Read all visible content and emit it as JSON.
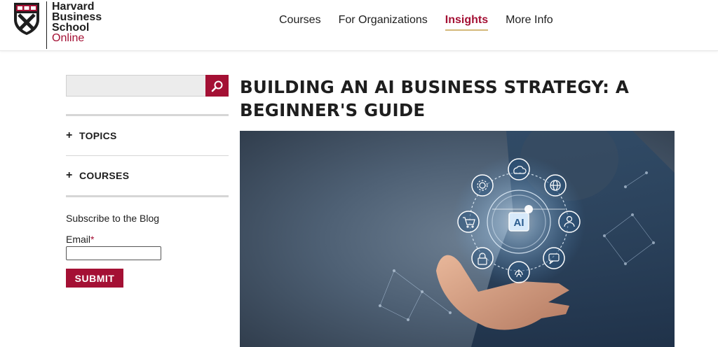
{
  "header": {
    "logo": {
      "line1": "Harvard",
      "line2": "Business",
      "line3": "School",
      "line4": "Online"
    },
    "nav": [
      {
        "label": "Courses",
        "active": false
      },
      {
        "label": "For Organizations",
        "active": false
      },
      {
        "label": "Insights",
        "active": true
      },
      {
        "label": "More Info",
        "active": false
      }
    ]
  },
  "sidebar": {
    "search": {
      "value": "",
      "placeholder": ""
    },
    "accordions": [
      {
        "label": "TOPICS",
        "icon": "plus-icon"
      },
      {
        "label": "COURSES",
        "icon": "plus-icon"
      }
    ],
    "subscribe": {
      "title": "Subscribe to the Blog",
      "email_label": "Email",
      "required_mark": "*",
      "submit_label": "SUBMIT"
    }
  },
  "article": {
    "title": "BUILDING AN AI BUSINESS STRATEGY: A BEGINNER'S GUIDE",
    "hero_image": {
      "center_label": "AI",
      "icons": [
        "cloud-icon",
        "globe-icon",
        "user-icon",
        "chat-icon",
        "fingerprint-icon",
        "lock-icon",
        "cart-icon",
        "gear-icon"
      ]
    }
  },
  "colors": {
    "brand": "#a41034",
    "nav_underline": "#d4b87a",
    "text": "#1e1e1e"
  }
}
